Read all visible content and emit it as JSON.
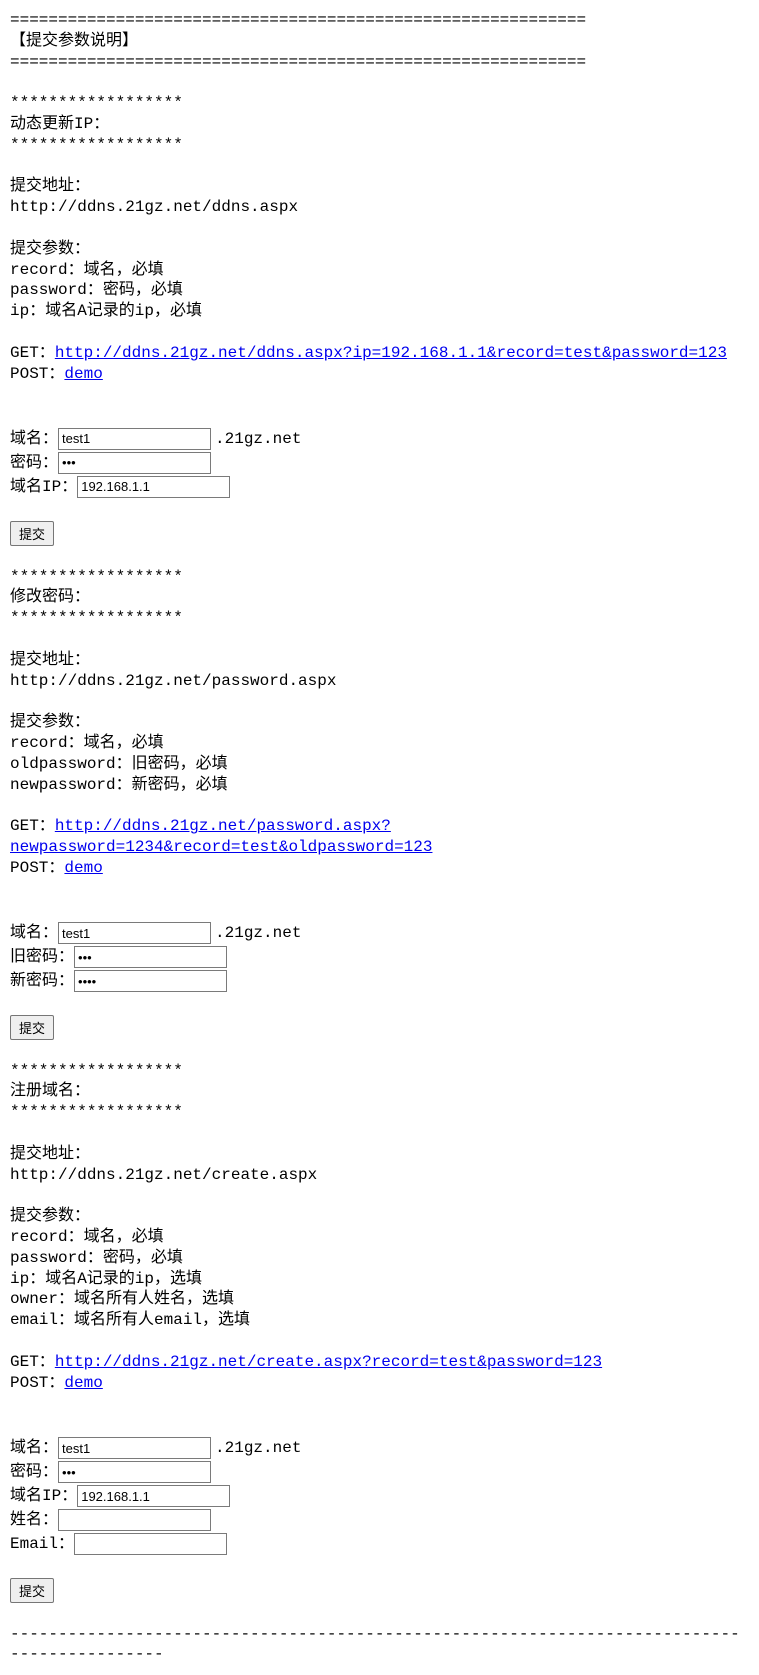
{
  "hr_eq": "============================================================",
  "hr_dash": "--------------------------------------------------------------------------------------------",
  "stars": "******************",
  "header_title": "【提交参数说明】",
  "common": {
    "submit_url_label": "提交地址：",
    "submit_params_label": "提交参数：",
    "get_label": "GET：",
    "post_label": "POST：",
    "post_link": "demo",
    "submit_btn": "提交",
    "domain_suffix": ".21gz.net"
  },
  "section1": {
    "title": "动态更新IP：",
    "url": "http://ddns.21gz.net/ddns.aspx",
    "params": [
      "record：域名，必填",
      "password：密码，必填",
      "ip：域名A记录的ip，必填"
    ],
    "get_link": "http://ddns.21gz.net/ddns.aspx?ip=192.168.1.1&record=test&password=123",
    "form": {
      "domain_label": "域名：",
      "domain_value": "test1",
      "password_label": "密码：",
      "password_value": "123",
      "ip_label": "域名IP：",
      "ip_value": "192.168.1.1"
    }
  },
  "section2": {
    "title": "修改密码：",
    "url": "http://ddns.21gz.net/password.aspx",
    "params": [
      "record：域名，必填",
      "oldpassword：旧密码，必填",
      "newpassword：新密码，必填"
    ],
    "get_link": "http://ddns.21gz.net/password.aspx?newpassword=1234&record=test&oldpassword=123",
    "form": {
      "domain_label": "域名：",
      "domain_value": "test1",
      "oldpw_label": "旧密码：",
      "oldpw_value": "123",
      "newpw_label": "新密码：",
      "newpw_value": "1234"
    }
  },
  "section3": {
    "title": "注册域名：",
    "url": "http://ddns.21gz.net/create.aspx",
    "params": [
      "record：域名，必填",
      "password：密码，必填",
      "ip：域名A记录的ip，选填",
      "owner：域名所有人姓名，选填",
      "email：域名所有人email，选填"
    ],
    "get_link": "http://ddns.21gz.net/create.aspx?record=test&password=123",
    "form": {
      "domain_label": "域名：",
      "domain_value": "test1",
      "password_label": "密码：",
      "password_value": "123",
      "ip_label": "域名IP：",
      "ip_value": "192.168.1.1",
      "name_label": "姓名：",
      "name_value": "",
      "email_label": "Email：",
      "email_value": ""
    }
  }
}
